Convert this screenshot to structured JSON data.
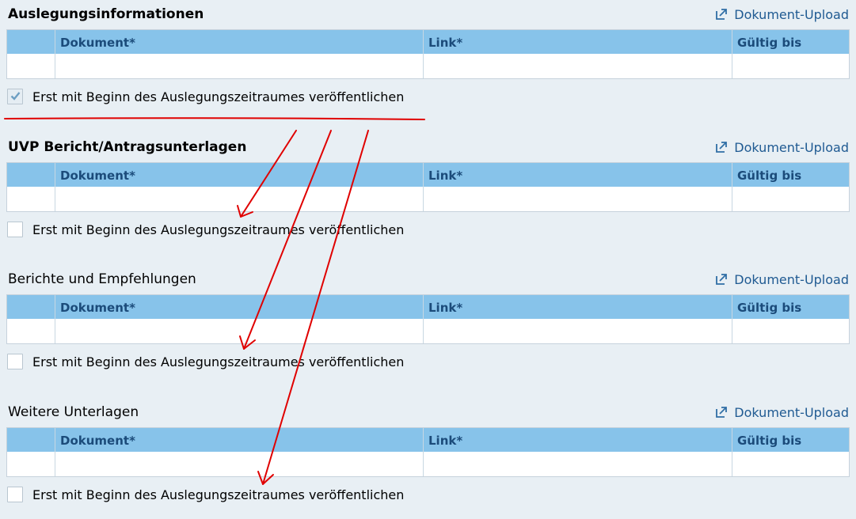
{
  "sections": [
    {
      "title": "Auslegungsinformationen",
      "bold": true,
      "upload_label": "Dokument-Upload",
      "columns": [
        "Dokument*",
        "Link*",
        "Gültig bis"
      ],
      "checkbox_label": "Erst mit Beginn des Auslegungszeitraumes veröffentlichen",
      "checked": true
    },
    {
      "title": "UVP Bericht/Antragsunterlagen",
      "bold": true,
      "upload_label": "Dokument-Upload",
      "columns": [
        "Dokument*",
        "Link*",
        "Gültig bis"
      ],
      "checkbox_label": "Erst mit Beginn des Auslegungszeitraumes veröffentlichen",
      "checked": false
    },
    {
      "title": "Berichte und Empfehlungen",
      "bold": false,
      "upload_label": "Dokument-Upload",
      "columns": [
        "Dokument*",
        "Link*",
        "Gültig bis"
      ],
      "checkbox_label": "Erst mit Beginn des Auslegungszeitraumes veröffentlichen",
      "checked": false
    },
    {
      "title": "Weitere Unterlagen",
      "bold": false,
      "upload_label": "Dokument-Upload",
      "columns": [
        "Dokument*",
        "Link*",
        "Gültig bis"
      ],
      "checkbox_label": "Erst mit Beginn des Auslegungszeitraumes veröffentlichen",
      "checked": false
    }
  ],
  "colors": {
    "background": "#e8eff4",
    "table_header": "#87c3ea",
    "header_text": "#1b4b7a",
    "link_text": "#1f5a92",
    "annotation_red": "#e00000",
    "checkmark": "#6d9fc3"
  },
  "icons": {
    "upload": "upload-arrow-icon",
    "checkmark": "checkmark-icon"
  }
}
